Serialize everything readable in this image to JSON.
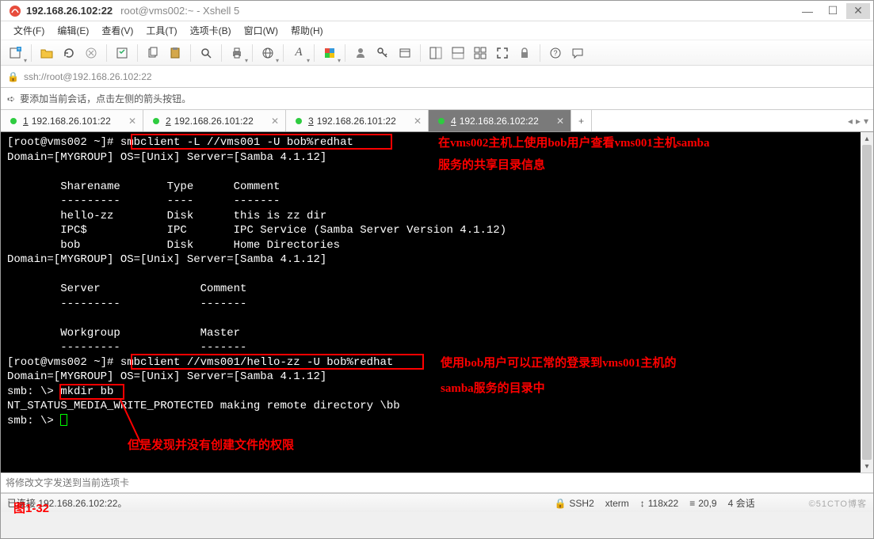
{
  "title": {
    "main": "192.168.26.102:22",
    "sub": "root@vms002:~ - Xshell 5"
  },
  "menu": {
    "file": "文件(F)",
    "edit": "编辑(E)",
    "view": "查看(V)",
    "tools": "工具(T)",
    "tab": "选项卡(B)",
    "window": "窗口(W)",
    "help": "帮助(H)"
  },
  "address": {
    "url": "ssh://root@192.168.26.102:22"
  },
  "infostrip": {
    "text": "要添加当前会话，点击左侧的箭头按钮。"
  },
  "tabs": [
    {
      "num": "1",
      "label": "192.168.26.101:22",
      "active": false
    },
    {
      "num": "2",
      "label": "192.168.26.101:22",
      "active": false
    },
    {
      "num": "3",
      "label": "192.168.26.101:22",
      "active": false
    },
    {
      "num": "4",
      "label": "192.168.26.102:22",
      "active": true
    }
  ],
  "terminal_lines": [
    "[root@vms002 ~]# smbclient -L //vms001 -U bob%redhat",
    "Domain=[MYGROUP] OS=[Unix] Server=[Samba 4.1.12]",
    "",
    "        Sharename       Type      Comment",
    "        ---------       ----      -------",
    "        hello-zz        Disk      this is zz dir",
    "        IPC$            IPC       IPC Service (Samba Server Version 4.1.12)",
    "        bob             Disk      Home Directories",
    "Domain=[MYGROUP] OS=[Unix] Server=[Samba 4.1.12]",
    "",
    "        Server               Comment",
    "        ---------            -------",
    "",
    "        Workgroup            Master",
    "        ---------            -------",
    "[root@vms002 ~]# smbclient //vms001/hello-zz -U bob%redhat",
    "Domain=[MYGROUP] OS=[Unix] Server=[Samba 4.1.12]",
    "smb: \\> mkdir bb",
    "NT_STATUS_MEDIA_WRITE_PROTECTED making remote directory \\bb",
    "smb: \\> "
  ],
  "annotations": {
    "a1_line1": "在vms002主机上使用bob用户查看vms001主机samba",
    "a1_line2": "服务的共享目录信息",
    "a2_line1": "使用bob用户可以正常的登录到vms001主机的",
    "a2_line2": "samba服务的目录中",
    "a3": "但是发现并没有创建文件的权限"
  },
  "bottom_input_placeholder": "将修改文字发送到当前选项卡",
  "figure_label": "图1-32",
  "status": {
    "left": "已连接 192.168.26.102:22。",
    "ssh": "SSH2",
    "term": "xterm",
    "size": "118x22",
    "pos": "20,9",
    "sessions": "4 会话",
    "watermark": "©51CTO博客"
  },
  "icons": {
    "lock": "🔒",
    "arrow": "➪",
    "updown": "↕",
    "lrarrows_l": "◂",
    "lrarrows_r": "▸",
    "dropdown": "▾"
  }
}
